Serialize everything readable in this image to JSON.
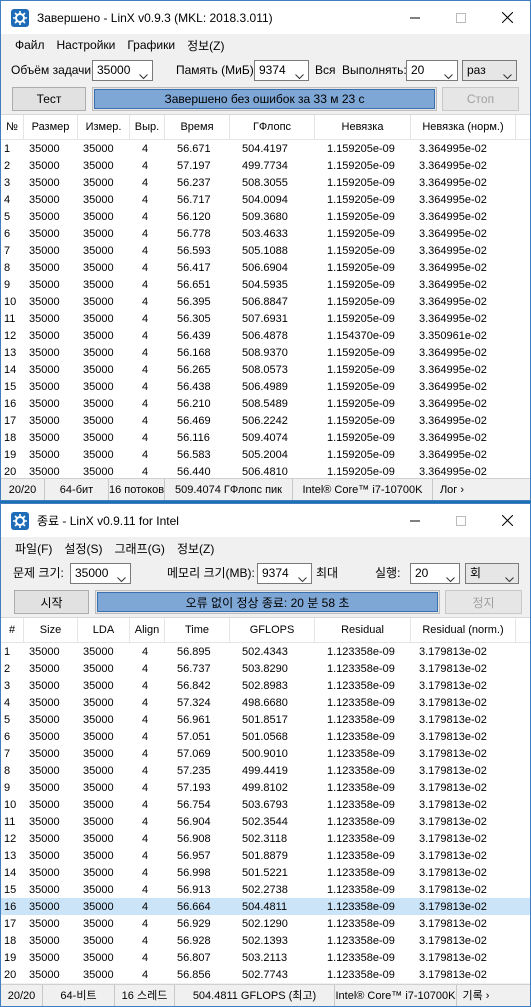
{
  "windows": [
    {
      "title": "Завершено - LinX v0.9.3 (MKL: 2018.3.011)",
      "menu": [
        "Файл",
        "Настройки",
        "Графики",
        "정보(Z)"
      ],
      "params": {
        "size_label": "Объём задачи:",
        "size_value": "35000",
        "mem_label": "Память (МиБ):",
        "mem_value": "9374",
        "all_label": "Вся",
        "run_label": "Выполнять:",
        "run_value": "20",
        "unit_value": "раз"
      },
      "test_button": "Тест",
      "stop_button": "Стоп",
      "progress": {
        "text": "Завершено без ошибок за 33 м 23 с",
        "fraction": 1.0
      },
      "columns": [
        "№",
        "Размер",
        "Измер.",
        "Выр.",
        "Время",
        "ГФлопс",
        "Невязка",
        "Невязка (норм.)"
      ],
      "rows": [
        [
          "1",
          "35000",
          "35000",
          "4",
          "56.671",
          "504.4197",
          "1.159205e-09",
          "3.364995e-02"
        ],
        [
          "2",
          "35000",
          "35000",
          "4",
          "57.197",
          "499.7734",
          "1.159205e-09",
          "3.364995e-02"
        ],
        [
          "3",
          "35000",
          "35000",
          "4",
          "56.237",
          "508.3055",
          "1.159205e-09",
          "3.364995e-02"
        ],
        [
          "4",
          "35000",
          "35000",
          "4",
          "56.717",
          "504.0094",
          "1.159205e-09",
          "3.364995e-02"
        ],
        [
          "5",
          "35000",
          "35000",
          "4",
          "56.120",
          "509.3680",
          "1.159205e-09",
          "3.364995e-02"
        ],
        [
          "6",
          "35000",
          "35000",
          "4",
          "56.778",
          "503.4633",
          "1.159205e-09",
          "3.364995e-02"
        ],
        [
          "7",
          "35000",
          "35000",
          "4",
          "56.593",
          "505.1088",
          "1.159205e-09",
          "3.364995e-02"
        ],
        [
          "8",
          "35000",
          "35000",
          "4",
          "56.417",
          "506.6904",
          "1.159205e-09",
          "3.364995e-02"
        ],
        [
          "9",
          "35000",
          "35000",
          "4",
          "56.651",
          "504.5935",
          "1.159205e-09",
          "3.364995e-02"
        ],
        [
          "10",
          "35000",
          "35000",
          "4",
          "56.395",
          "506.8847",
          "1.159205e-09",
          "3.364995e-02"
        ],
        [
          "11",
          "35000",
          "35000",
          "4",
          "56.305",
          "507.6931",
          "1.159205e-09",
          "3.364995e-02"
        ],
        [
          "12",
          "35000",
          "35000",
          "4",
          "56.439",
          "506.4878",
          "1.154370e-09",
          "3.350961e-02"
        ],
        [
          "13",
          "35000",
          "35000",
          "4",
          "56.168",
          "508.9370",
          "1.159205e-09",
          "3.364995e-02"
        ],
        [
          "14",
          "35000",
          "35000",
          "4",
          "56.265",
          "508.0573",
          "1.159205e-09",
          "3.364995e-02"
        ],
        [
          "15",
          "35000",
          "35000",
          "4",
          "56.438",
          "506.4989",
          "1.159205e-09",
          "3.364995e-02"
        ],
        [
          "16",
          "35000",
          "35000",
          "4",
          "56.210",
          "508.5489",
          "1.159205e-09",
          "3.364995e-02"
        ],
        [
          "17",
          "35000",
          "35000",
          "4",
          "56.469",
          "506.2242",
          "1.159205e-09",
          "3.364995e-02"
        ],
        [
          "18",
          "35000",
          "35000",
          "4",
          "56.116",
          "509.4074",
          "1.159205e-09",
          "3.364995e-02"
        ],
        [
          "19",
          "35000",
          "35000",
          "4",
          "56.583",
          "505.2004",
          "1.159205e-09",
          "3.364995e-02"
        ],
        [
          "20",
          "35000",
          "35000",
          "4",
          "56.440",
          "506.4810",
          "1.159205e-09",
          "3.364995e-02"
        ]
      ],
      "selected_row": -1,
      "status": [
        "20/20",
        "64-бит",
        "16 потоков",
        "509.4074 ГФлопс пик",
        "Intel® Core™ i7-10700K",
        "Лог ›"
      ]
    },
    {
      "title": "종료 - LinX v0.9.11 for Intel",
      "menu": [
        "파일(F)",
        "설정(S)",
        "그래프(G)",
        "정보(Z)"
      ],
      "params": {
        "size_label": "문제 크기:",
        "size_value": "35000",
        "mem_label": "메모리 크기(MB):",
        "mem_value": "9374",
        "all_label": "최대",
        "run_label": "실행:",
        "run_value": "20",
        "unit_value": "회"
      },
      "test_button": "시작",
      "stop_button": "정지",
      "progress": {
        "text": "오류 없이 정상 종료: 20 분 58 초",
        "fraction": 1.0
      },
      "columns": [
        "#",
        "Size",
        "LDA",
        "Align",
        "Time",
        "GFLOPS",
        "Residual",
        "Residual (norm.)"
      ],
      "rows": [
        [
          "1",
          "35000",
          "35000",
          "4",
          "56.895",
          "502.4343",
          "1.123358e-09",
          "3.179813e-02"
        ],
        [
          "2",
          "35000",
          "35000",
          "4",
          "56.737",
          "503.8290",
          "1.123358e-09",
          "3.179813e-02"
        ],
        [
          "3",
          "35000",
          "35000",
          "4",
          "56.842",
          "502.8983",
          "1.123358e-09",
          "3.179813e-02"
        ],
        [
          "4",
          "35000",
          "35000",
          "4",
          "57.324",
          "498.6680",
          "1.123358e-09",
          "3.179813e-02"
        ],
        [
          "5",
          "35000",
          "35000",
          "4",
          "56.961",
          "501.8517",
          "1.123358e-09",
          "3.179813e-02"
        ],
        [
          "6",
          "35000",
          "35000",
          "4",
          "57.051",
          "501.0568",
          "1.123358e-09",
          "3.179813e-02"
        ],
        [
          "7",
          "35000",
          "35000",
          "4",
          "57.069",
          "500.9010",
          "1.123358e-09",
          "3.179813e-02"
        ],
        [
          "8",
          "35000",
          "35000",
          "4",
          "57.235",
          "499.4419",
          "1.123358e-09",
          "3.179813e-02"
        ],
        [
          "9",
          "35000",
          "35000",
          "4",
          "57.193",
          "499.8102",
          "1.123358e-09",
          "3.179813e-02"
        ],
        [
          "10",
          "35000",
          "35000",
          "4",
          "56.754",
          "503.6793",
          "1.123358e-09",
          "3.179813e-02"
        ],
        [
          "11",
          "35000",
          "35000",
          "4",
          "56.904",
          "502.3544",
          "1.123358e-09",
          "3.179813e-02"
        ],
        [
          "12",
          "35000",
          "35000",
          "4",
          "56.908",
          "502.3118",
          "1.123358e-09",
          "3.179813e-02"
        ],
        [
          "13",
          "35000",
          "35000",
          "4",
          "56.957",
          "501.8879",
          "1.123358e-09",
          "3.179813e-02"
        ],
        [
          "14",
          "35000",
          "35000",
          "4",
          "56.998",
          "501.5221",
          "1.123358e-09",
          "3.179813e-02"
        ],
        [
          "15",
          "35000",
          "35000",
          "4",
          "56.913",
          "502.2738",
          "1.123358e-09",
          "3.179813e-02"
        ],
        [
          "16",
          "35000",
          "35000",
          "4",
          "56.664",
          "504.4811",
          "1.123358e-09",
          "3.179813e-02"
        ],
        [
          "17",
          "35000",
          "35000",
          "4",
          "56.929",
          "502.1290",
          "1.123358e-09",
          "3.179813e-02"
        ],
        [
          "18",
          "35000",
          "35000",
          "4",
          "56.928",
          "502.1393",
          "1.123358e-09",
          "3.179813e-02"
        ],
        [
          "19",
          "35000",
          "35000",
          "4",
          "56.807",
          "503.2113",
          "1.123358e-09",
          "3.179813e-02"
        ],
        [
          "20",
          "35000",
          "35000",
          "4",
          "56.856",
          "502.7743",
          "1.123358e-09",
          "3.179813e-02"
        ]
      ],
      "selected_row": 15,
      "status": [
        "20/20",
        "64-비트",
        "16 스레드",
        "504.4811 GFLOPS (최고)",
        "Intel® Core™ i7-10700K",
        "기록 ›"
      ]
    }
  ],
  "colors": {
    "progress_fill": "#7fa7d6",
    "selection": "#cce4f7",
    "desktop": "#1b6fb5"
  }
}
